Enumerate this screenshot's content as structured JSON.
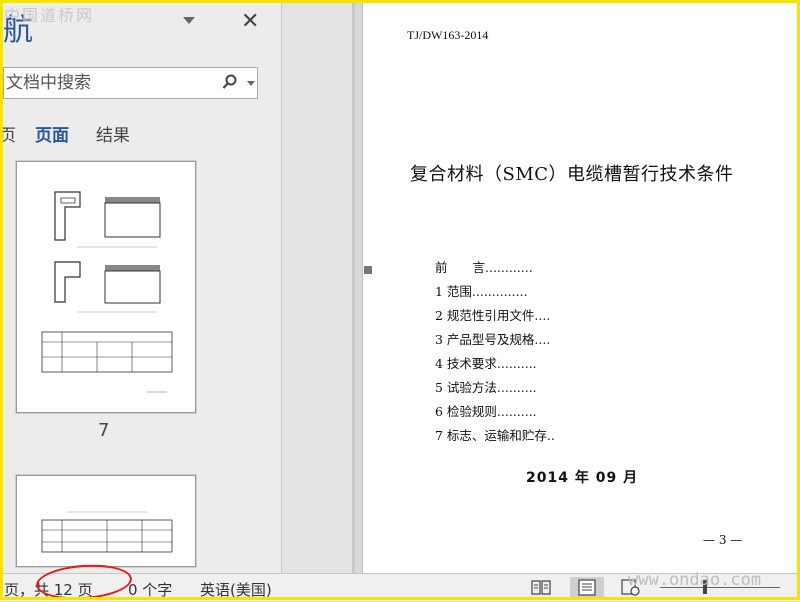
{
  "nav": {
    "title": "航",
    "search_placeholder": "文档中搜索",
    "tabs": [
      "页",
      "页面",
      "结果"
    ],
    "thumbnail_label": "7"
  },
  "document": {
    "standard_code": "TJ/DW163-2014",
    "title": "复合材料（SMC）电缆槽暂行技术条件",
    "toc": [
      "前　　言............",
      "1  范围..............",
      "2  规范性引用文件....",
      "3  产品型号及规格....",
      "4  技术要求..........",
      "5  试验方法..........",
      "6  检验规则..........",
      "7  标志、运输和贮存.."
    ],
    "date": "2014 年 09 月",
    "page_number": "— 3 —"
  },
  "status": {
    "page_info": "页，共 12 页",
    "word_count": "0 个字",
    "language": "英语(美国)"
  },
  "watermarks": {
    "top": "中国道桥网",
    "bottom": "www.ondao.com"
  },
  "colors": {
    "accent": "#2b579a",
    "border": "#f2e600",
    "oval": "#e21b1b"
  }
}
